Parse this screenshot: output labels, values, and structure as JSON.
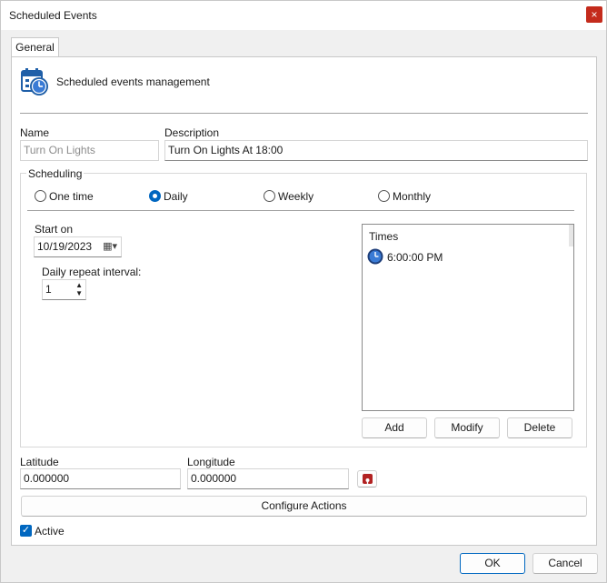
{
  "window": {
    "title": "Scheduled Events",
    "close_glyph": "×"
  },
  "tabs": [
    {
      "label": "General"
    }
  ],
  "header": {
    "icon": "calendar-clock-icon",
    "text": "Scheduled events management"
  },
  "fields": {
    "name_label": "Name",
    "name_value": "Turn On Lights",
    "description_label": "Description",
    "description_value": "Turn On Lights At 18:00"
  },
  "scheduling": {
    "group_label": "Scheduling",
    "options": [
      {
        "label": "One time",
        "checked": false
      },
      {
        "label": "Daily",
        "checked": true
      },
      {
        "label": "Weekly",
        "checked": false
      },
      {
        "label": "Monthly",
        "checked": false
      }
    ],
    "start_on_label": "Start on",
    "start_on_value": "10/19/2023",
    "repeat_label": "Daily repeat interval:",
    "repeat_value": "1",
    "times_header": "Times",
    "times": [
      {
        "value": "6:00:00 PM",
        "icon": "clock-icon"
      }
    ],
    "add_label": "Add",
    "modify_label": "Modify",
    "delete_label": "Delete"
  },
  "location": {
    "latitude_label": "Latitude",
    "latitude_value": "0.000000",
    "longitude_label": "Longitude",
    "longitude_value": "0.000000",
    "map_button_icon": "map-pin-icon"
  },
  "configure_actions_label": "Configure Actions",
  "active": {
    "label": "Active",
    "checked": true
  },
  "footer": {
    "ok_label": "OK",
    "cancel_label": "Cancel"
  },
  "colors": {
    "accent": "#0067c0",
    "close": "#c42b1c",
    "map_button": "#b22222"
  }
}
